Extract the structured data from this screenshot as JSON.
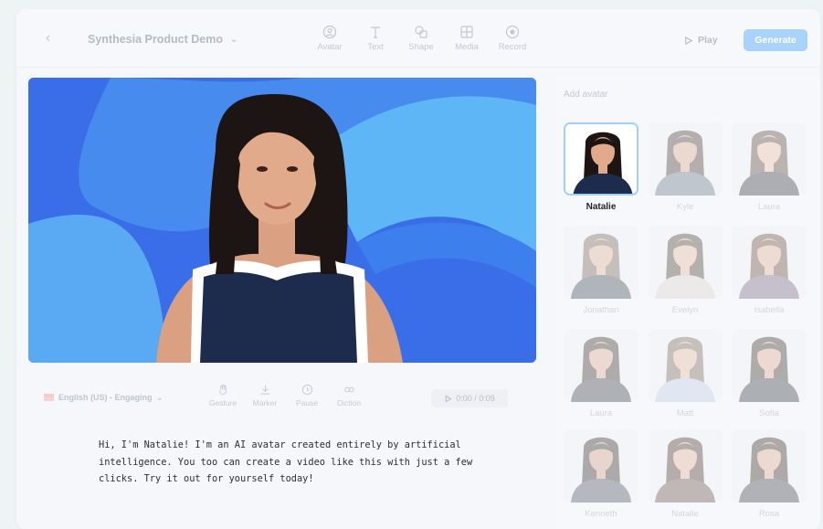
{
  "header": {
    "back_icon": "chevron-left-icon",
    "title": "Synthesia Product Demo",
    "tools": [
      {
        "label": "Avatar",
        "icon": "avatar-icon"
      },
      {
        "label": "Text",
        "icon": "text-icon"
      },
      {
        "label": "Shape",
        "icon": "shape-icon"
      },
      {
        "label": "Media",
        "icon": "media-icon"
      },
      {
        "label": "Record",
        "icon": "record-icon"
      }
    ],
    "play_label": "Play",
    "generate_label": "Generate"
  },
  "editor": {
    "language": "English (US) - Engaging",
    "controls": [
      {
        "label": "Gesture",
        "icon": "gesture-icon"
      },
      {
        "label": "Marker",
        "icon": "marker-icon"
      },
      {
        "label": "Pause",
        "icon": "pause-clock-icon"
      },
      {
        "label": "Diction",
        "icon": "diction-icon"
      }
    ],
    "timer": "0:00 / 0:09",
    "script": "Hi, I'm Natalie! I'm an AI avatar created entirely by artificial\nintelligence. You too can create a video like this with just a few\nclicks. Try it out for yourself today!"
  },
  "avatar_panel": {
    "title": "Add avatar",
    "avatars": [
      {
        "name": "Natalie",
        "selected": true
      },
      {
        "name": "Kyle"
      },
      {
        "name": "Laura"
      },
      {
        "name": "Jonathan"
      },
      {
        "name": "Evelyn"
      },
      {
        "name": "Isabella"
      },
      {
        "name": "Laura"
      },
      {
        "name": "Matt"
      },
      {
        "name": "Sofia"
      },
      {
        "name": "Kenneth"
      },
      {
        "name": "Natalie"
      },
      {
        "name": "Rosa"
      }
    ]
  },
  "colors": {
    "accent": "#a9d3fb",
    "canvas_bg": "#3b74ea",
    "selected_border": "#9fd0fb"
  }
}
